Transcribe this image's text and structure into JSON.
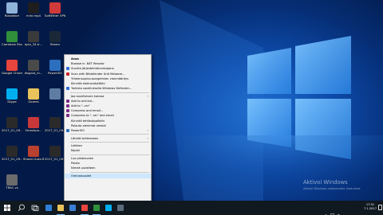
{
  "desktop_icons": [
    {
      "label": "Roskakori",
      "color": "#8fb3d9",
      "icon": "recycle-bin-icon"
    },
    {
      "label": "mini.mp4",
      "color": "#1e1e1e",
      "icon": "video-file-icon"
    },
    {
      "label": "SoftEther VPN Clie...",
      "color": "#d23a3a",
      "icon": "vpn-client-icon"
    },
    {
      "label": "Camtasia Studio 8",
      "color": "#2f8f3a",
      "icon": "camtasia-icon"
    },
    {
      "label": "ajax_34.tr...",
      "color": "#3a3a3a",
      "icon": "file-icon"
    },
    {
      "label": "Steam",
      "color": "#1b2838",
      "icon": "steam-icon"
    },
    {
      "label": "Google Chrome",
      "color": "#e8453c",
      "icon": "chrome-icon"
    },
    {
      "label": "disgaia_m...",
      "color": "#4a4a4a",
      "icon": "file-icon"
    },
    {
      "label": "PowerISO",
      "color": "#2c6fbf",
      "icon": "poweriso-icon"
    },
    {
      "label": "Skype",
      "color": "#00aff0",
      "icon": "skype-icon"
    },
    {
      "label": "Games",
      "color": "#e8c25a",
      "icon": "folder-icon"
    },
    {
      "label": "",
      "color": "#5f7da3",
      "icon": "file-icon"
    },
    {
      "label": "2017_01_09...",
      "color": "#2a2a2a",
      "icon": "video-file-icon"
    },
    {
      "label": "Smashpo...",
      "color": "#c8383a",
      "icon": "game-icon"
    },
    {
      "label": "2017_01_09...",
      "color": "#2a2a2a",
      "icon": "video-file-icon"
    },
    {
      "label": "2017_01_09...",
      "color": "#2a2a2a",
      "icon": "video-file-icon"
    },
    {
      "label": "Shovel Auto Baldurs...",
      "color": "#b9412f",
      "icon": "game-icon"
    },
    {
      "label": "2017_01_09...",
      "color": "#2a2a2a",
      "icon": "video-file-icon"
    },
    {
      "label": "TRAC.vs",
      "color": "#6b6b6b",
      "icon": "file-icon"
    }
  ],
  "context_menu": {
    "items": [
      {
        "label": "Avaa",
        "bold": true,
        "icon": "",
        "submenu": false
      },
      {
        "label": "Browse in .NET Reactor",
        "icon": "",
        "submenu": false
      },
      {
        "label": "Suorita järjestelmänvalvojana",
        "icon": "shield-icon",
        "submenu": false
      },
      {
        "label": "Scan with Bitdefender Anti Malware...",
        "icon": "bitdefender-icon",
        "submenu": false
      },
      {
        "label": "Yhteensopivuusongelmien vianmääritys",
        "icon": "",
        "submenu": false
      },
      {
        "label": "Kiinnitä aloitusnäyttöön",
        "icon": "",
        "submenu": false
      },
      {
        "label": "Tarkista sovelluksella Windows Defender...",
        "icon": "defender-icon",
        "submenu": false
      },
      {
        "sep": true
      },
      {
        "label": "Jaa sovelluksen kanssa",
        "icon": "",
        "submenu": true
      },
      {
        "label": "Add to archive...",
        "icon": "winrar-icon",
        "submenu": false
      },
      {
        "label": "Add to \"-.rar\"",
        "icon": "winrar-icon",
        "submenu": false
      },
      {
        "label": "Compress and email...",
        "icon": "winrar-icon",
        "submenu": false
      },
      {
        "label": "Compress to \"-.rar\" and email",
        "icon": "winrar-icon",
        "submenu": false
      },
      {
        "label": "Kiinnitä tehtäväpalkkiin",
        "icon": "",
        "submenu": false
      },
      {
        "label": "Palauta aiemmat versiot",
        "icon": "",
        "submenu": false
      },
      {
        "label": "PowerISO",
        "icon": "poweriso-icon",
        "submenu": true
      },
      {
        "sep": true
      },
      {
        "label": "Lähetä kohteeseen",
        "icon": "",
        "submenu": true
      },
      {
        "sep": true
      },
      {
        "label": "Leikkaa",
        "icon": "",
        "submenu": false
      },
      {
        "label": "Kopioi",
        "icon": "",
        "submenu": false
      },
      {
        "sep": true
      },
      {
        "label": "Luo pikakuvake",
        "icon": "",
        "submenu": false
      },
      {
        "label": "Poista",
        "icon": "",
        "submenu": false
      },
      {
        "label": "Nimeä uudelleen",
        "icon": "",
        "submenu": false
      },
      {
        "sep": true
      },
      {
        "label": "Ominaisuudet",
        "icon": "",
        "submenu": false,
        "highlight": true
      }
    ]
  },
  "watermark": {
    "title": "Aktivoi Windows",
    "subtitle": "Aktivoi Windows valitsemalla Asetukset."
  },
  "taskbar": {
    "apps": [
      {
        "name": "edge-icon",
        "color": "#2f7fd6",
        "active": false
      },
      {
        "name": "file-explorer-icon",
        "color": "#e8c25a",
        "active": true
      },
      {
        "name": "store-icon",
        "color": "#3a7fd6",
        "active": false
      },
      {
        "name": "chrome-icon",
        "color": "#e8453c",
        "active": true
      },
      {
        "name": "camtasia-icon",
        "color": "#2f8f3a",
        "active": true
      },
      {
        "name": "skype-icon",
        "color": "#00aff0",
        "active": false
      },
      {
        "name": "steam-icon",
        "color": "#5c6c7c",
        "active": false
      }
    ],
    "time": "17:51",
    "date": "7.1.2017"
  }
}
